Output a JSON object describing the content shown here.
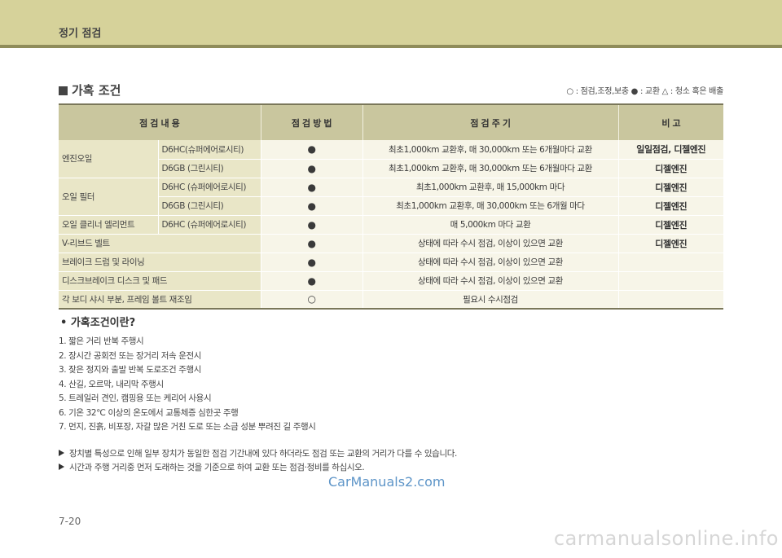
{
  "header": {
    "title": "정기 점검"
  },
  "section": {
    "title": "가혹 조건"
  },
  "legend": {
    "text": "○ : 점검,조정,보충  ● : 교환  △ : 청소 혹은 배출"
  },
  "table": {
    "headers": {
      "item": "점    검    내    용",
      "method": "점 검 방 법",
      "cycle": "점    검    주    기",
      "note": "비    고"
    },
    "rows": [
      {
        "item": "엔진오일",
        "sub": "D6HC(슈퍼에어로시티)",
        "method": "●",
        "cycle": "최초1,000km 교환후, 매 30,000km 또는 6개월마다 교환",
        "note": "일일점검, 디젤엔진"
      },
      {
        "sub": "D6GB (그린시티)",
        "method": "●",
        "cycle": "최초1,000km 교환후, 매 30,000km 또는 6개월마다 교환",
        "note": "디젤엔진"
      },
      {
        "item": "오일 필터",
        "sub": "D6HC (슈퍼에어로시티)",
        "method": "●",
        "cycle": "최초1,000km 교환후, 매 15,000km 마다",
        "note": "디젤엔진"
      },
      {
        "sub": "D6GB (그린시티)",
        "method": "●",
        "cycle": "최초1,000km 교환후, 매 30,000km 또는 6개월 마다",
        "note": "디젤엔진"
      },
      {
        "item": "오일 클리너 엘리먼트",
        "sub": "D6HC (슈퍼에어로시티)",
        "method": "●",
        "cycle": "매 5,000km 마다 교환",
        "note": "디젤엔진"
      },
      {
        "item": "V-리브드 벨트",
        "method": "●",
        "cycle": "상태에 따라 수시 점검, 이상이 있으면 교환",
        "note": "디젤엔진"
      },
      {
        "item": "브레이크 드럼 및 라이닝",
        "method": "●",
        "cycle": "상태에 따라 수시 점검, 이상이 있으면 교환",
        "note": ""
      },
      {
        "item": "디스크브레이크 디스크 및 패드",
        "method": "●",
        "cycle": "상태에 따라 수시 점검, 이상이 있으면 교환",
        "note": ""
      },
      {
        "item": "각 보디 샤시 부분, 프레임 볼트 재조임",
        "method": "○",
        "cycle": "필요시 수시점검",
        "note": ""
      }
    ]
  },
  "severe": {
    "title": "• 가혹조건이란?",
    "items": [
      "1. 짧은 거리 반복 주행시",
      "2. 장시간 공회전 또는 장거리 저속 운전시",
      "3. 잦은 정지와 출발 반복 도로조건 주행시",
      "4. 산길, 오르막, 내리막 주행시",
      "5. 트레일러 견인, 캠핑용 또는 케리어 사용시",
      "6. 기온 32℃ 이상의 온도에서 교통체증 심한곳 주행",
      "7. 먼지, 진흙, 비포장, 자갈 많은 거친 도로  또는 소금  성분 뿌려진 길 주행시"
    ]
  },
  "notes": [
    "장치별 특성으로 인해 일부 장치가 동일한 점검 기간내에 있다 하더라도 점검 또는 교환의 거리가 다를 수 있습니다.",
    "시간과 주행 거리중 먼저 도래하는 것을 기준으로 하여 교환 또는 점검·정비를 하십시오."
  ],
  "watermark": "CarManuals2.com",
  "page_number": "7-20",
  "site": "carmanualsonline.info"
}
